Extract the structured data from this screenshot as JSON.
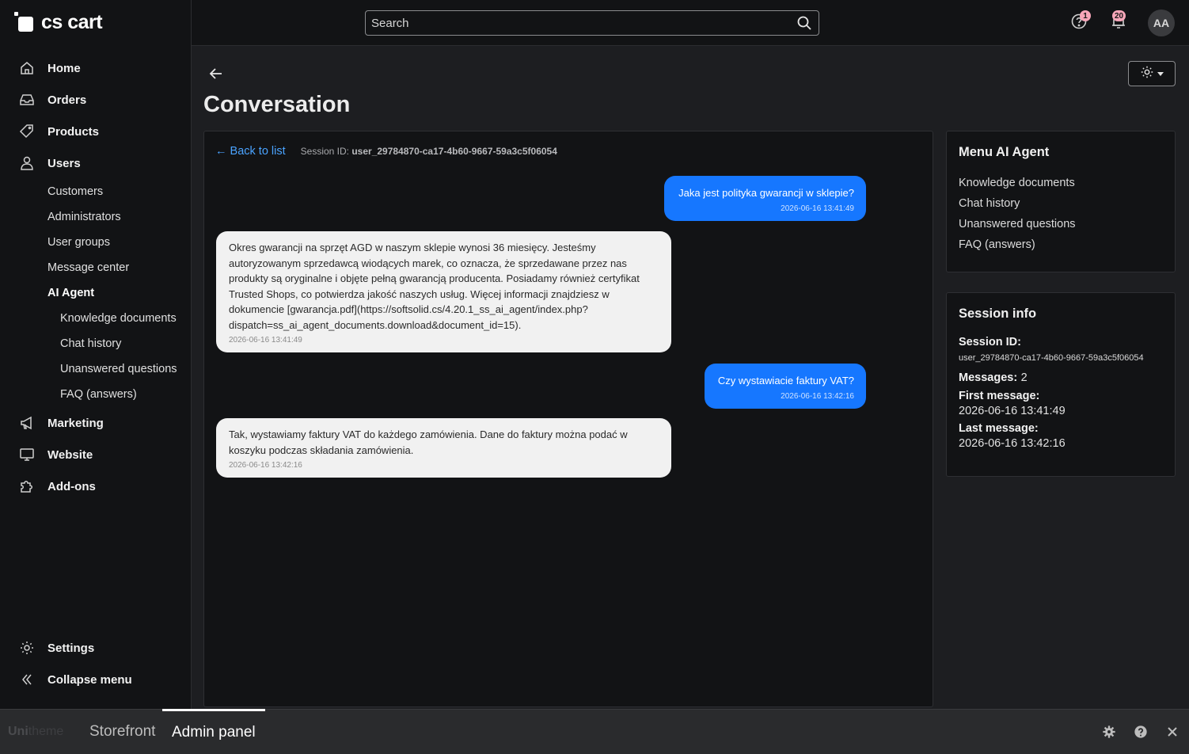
{
  "brand": {
    "logo_text": "cs cart"
  },
  "sidebar": {
    "items": [
      {
        "label": "Home",
        "icon": "home-icon"
      },
      {
        "label": "Orders",
        "icon": "inbox-icon"
      },
      {
        "label": "Products",
        "icon": "tag-icon"
      },
      {
        "label": "Users",
        "icon": "user-icon"
      }
    ],
    "users_sub": [
      "Customers",
      "Administrators",
      "User groups",
      "Message center",
      "AI Agent"
    ],
    "ai_agent_sub": [
      "Knowledge documents",
      "Chat history",
      "Unanswered questions",
      "FAQ (answers)"
    ],
    "more_items": [
      {
        "label": "Marketing",
        "icon": "megaphone-icon"
      },
      {
        "label": "Website",
        "icon": "monitor-icon"
      },
      {
        "label": "Add-ons",
        "icon": "puzzle-icon"
      }
    ],
    "bottom": [
      {
        "label": "Settings",
        "icon": "gear-icon"
      },
      {
        "label": "Collapse menu",
        "icon": "double-chevron-left-icon"
      }
    ]
  },
  "topbar": {
    "search_placeholder": "Search",
    "help_badge": "1",
    "notifications_badge": "20",
    "avatar_initials": "AA"
  },
  "page": {
    "title": "Conversation"
  },
  "chat": {
    "back_link": "← Back to list",
    "session_label": "Session ID:",
    "session_id": "user_29784870-ca17-4b60-9667-59a3c5f06054",
    "messages": [
      {
        "role": "user",
        "text": "Jaka jest polityka gwarancji w sklepie?",
        "time": "2026-06-16 13:41:49"
      },
      {
        "role": "bot",
        "text": "Okres gwarancji na sprzęt AGD w naszym sklepie wynosi 36 miesięcy. Jesteśmy autoryzowanym sprzedawcą wiodących marek, co oznacza, że sprzedawane przez nas produkty są oryginalne i objęte pełną gwarancją producenta. Posiadamy również certyfikat Trusted Shops, co potwierdza jakość naszych usług. Więcej informacji znajdziesz w dokumencie [gwarancja.pdf](https://softsolid.cs/4.20.1_ss_ai_agent/index.php?dispatch=ss_ai_agent_documents.download&document_id=15).",
        "time": "2026-06-16 13:41:49"
      },
      {
        "role": "user",
        "text": "Czy wystawiacie faktury VAT?",
        "time": "2026-06-16 13:42:16"
      },
      {
        "role": "bot",
        "text": "Tak, wystawiamy faktury VAT do każdego zamówienia. Dane do faktury można podać w koszyku podczas składania zamówienia.",
        "time": "2026-06-16 13:42:16"
      }
    ]
  },
  "menu_card": {
    "title": "Menu AI Agent",
    "links": [
      "Knowledge documents",
      "Chat history",
      "Unanswered questions",
      "FAQ (answers)"
    ]
  },
  "session_card": {
    "title": "Session info",
    "session_id_label": "Session ID:",
    "session_id": "user_29784870-ca17-4b60-9667-59a3c5f06054",
    "messages_label": "Messages:",
    "messages_count": "2",
    "first_label": "First message:",
    "first_value": "2026-06-16 13:41:49",
    "last_label": "Last message:",
    "last_value": "2026-06-16 13:42:16"
  },
  "footer": {
    "logo_a": "Uni",
    "logo_b": "theme",
    "tabs": [
      "Storefront",
      "Admin panel"
    ]
  },
  "colors": {
    "accent": "#1677ff",
    "link": "#4aa3ff",
    "badge": "#f7a6b9",
    "bg": "#1d1e21",
    "panel": "#121315"
  }
}
